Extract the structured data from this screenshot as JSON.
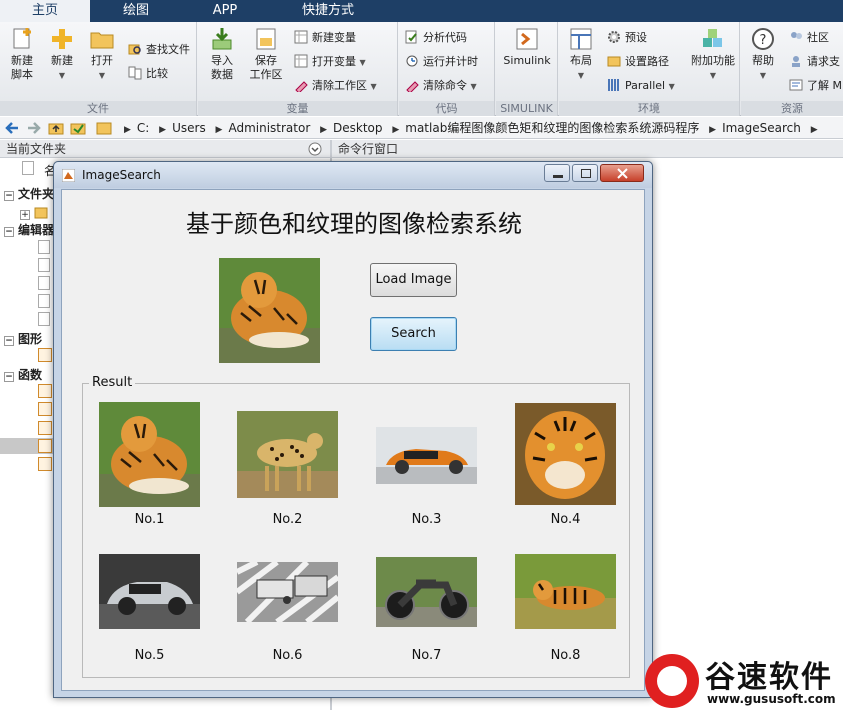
{
  "ribbon": {
    "tabs": [
      "主页",
      "绘图",
      "APP",
      "快捷方式"
    ],
    "file_section": {
      "label": "文件",
      "new_script": "新建\n脚本",
      "new": "新建",
      "open": "打开",
      "find_files": "查找文件",
      "compare": "比较"
    },
    "variable_section": {
      "label": "变量",
      "import_data": "导入\n数据",
      "save_workspace": "保存\n工作区",
      "new_variable": "新建变量",
      "open_variable": "打开变量",
      "clear_workspace": "清除工作区"
    },
    "code_section": {
      "label": "代码",
      "analyze_code": "分析代码",
      "run_and_time": "运行并计时",
      "clear_commands": "清除命令"
    },
    "simulink_section": {
      "label": "SIMULINK",
      "simulink": "Simulink"
    },
    "environment_section": {
      "label": "环境",
      "layout": "布局",
      "preferences": "预设",
      "set_path": "设置路径",
      "parallel": "Parallel",
      "add_ons": "附加功能"
    },
    "resources_section": {
      "label": "资源",
      "help": "帮助",
      "community": "社区",
      "request_support": "请求支",
      "learn": "了解 M"
    }
  },
  "address": {
    "crumbs": [
      "C:",
      "Users",
      "Administrator",
      "Desktop",
      "matlab编程图像颜色矩和纹理的图像检索系统源码程序",
      "ImageSearch"
    ]
  },
  "panels": {
    "current_folder": "当前文件夹",
    "command_window": "命令行窗口",
    "tree": {
      "file_folder": "文件夹",
      "editor": "编辑器",
      "figures": "图形",
      "functions": "函数",
      "name_col": "名"
    }
  },
  "window": {
    "title": "ImageSearch",
    "app_title": "基于颜色和纹理的图像检索系统",
    "load_button": "Load Image",
    "search_button": "Search",
    "result_label": "Result",
    "results": [
      "No.1",
      "No.2",
      "No.3",
      "No.4",
      "No.5",
      "No.6",
      "No.7",
      "No.8"
    ]
  },
  "watermark": {
    "name": "谷速软件",
    "url": "www.gususoft.com"
  }
}
